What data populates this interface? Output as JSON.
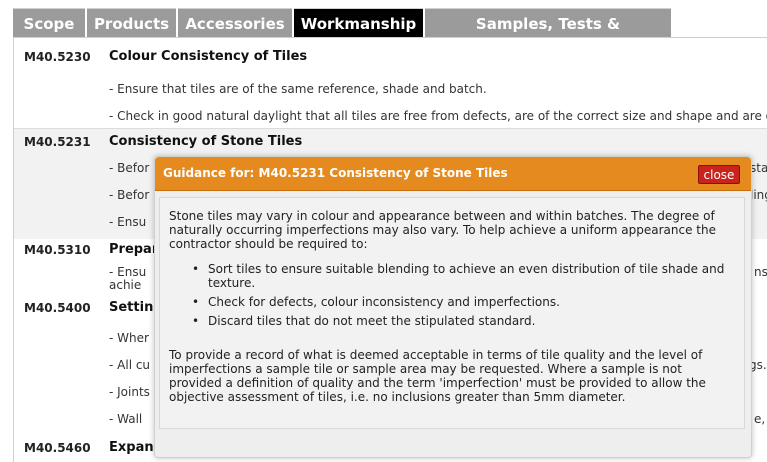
{
  "tabs": [
    {
      "label": "Scope"
    },
    {
      "label": "Products"
    },
    {
      "label": "Accessories"
    },
    {
      "label": "Workmanship",
      "active": true
    },
    {
      "label": "Samples, Tests & Certificates"
    }
  ],
  "clauses": [
    {
      "code": "M40.5230",
      "title": "Colour Consistency of Tiles",
      "lines": [
        "- Ensure that tiles are of the same reference, shade and batch.",
        "- Check in good natural daylight that all tiles are free from defects, are of the correct size and shape and are of a c"
      ]
    },
    {
      "code": "M40.5231",
      "title": "Consistency of Stone Tiles",
      "lines": [
        "- Befor",
        "- Befor",
        "- Ensu"
      ],
      "right_fragments": [
        "sta",
        "ling",
        ""
      ]
    },
    {
      "code": "M40.5310",
      "title": "Prepar",
      "lines": [
        "- Ensu",
        "  achie"
      ],
      "right_fragments": [
        "ns",
        ""
      ]
    },
    {
      "code": "M40.5400",
      "title": "Setting",
      "lines": [
        "- Wher",
        "- All cu",
        "- Joints",
        "- Wall"
      ],
      "right_fragments": [
        "",
        "gs.",
        "",
        "e,"
      ]
    },
    {
      "code": "M40.5460",
      "title": "Expan",
      "lines": []
    }
  ],
  "modal": {
    "title": "Guidance for: M40.5231 Consistency of Stone Tiles",
    "close_label": "close",
    "intro": "Stone tiles may vary in colour and appearance between and within batches. The degree of naturally occurring imperfections may also vary. To help achieve a uniform appearance the contractor should be required to:",
    "bullets": [
      "Sort tiles to ensure suitable blending to achieve an even distribution of tile shade and texture.",
      "Check for defects, colour inconsistency and imperfections.",
      "Discard tiles that do not meet the stipulated standard."
    ],
    "outro": "To provide a record of what is deemed acceptable in terms of tile quality and the level of imperfections a sample tile or sample area may be requested. Where a sample is not provided a definition of quality and the term 'imperfection' must be provided to allow the objective assessment of tiles, i.e. no inclusions greater than 5mm diameter."
  },
  "colors": {
    "tab_inactive": "#9b9b9b",
    "tab_active": "#000000",
    "modal_header": "#e58a1f",
    "close_button": "#c9231e"
  }
}
